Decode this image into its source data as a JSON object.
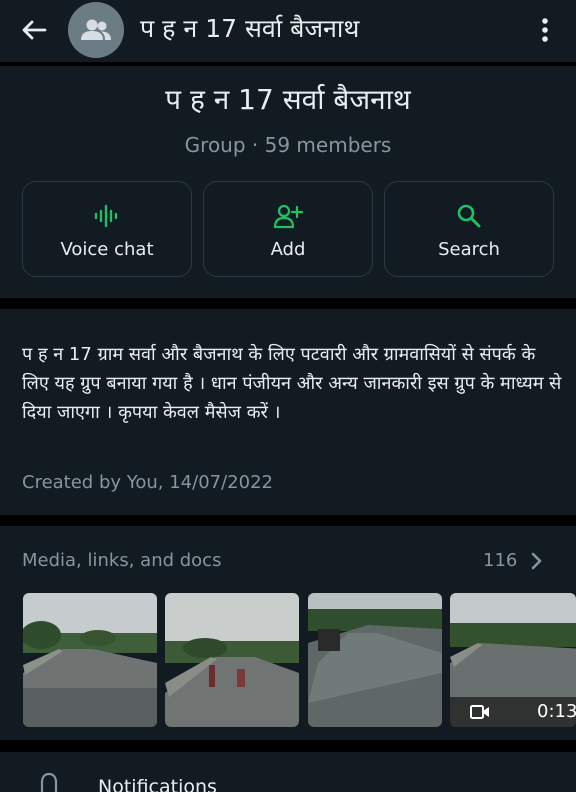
{
  "header": {
    "title": "प ह न 17 सर्वा बैजनाथ",
    "back_icon": "arrow-left-icon",
    "avatar_icon": "group-icon",
    "menu_icon": "more-vertical-icon"
  },
  "profile": {
    "name": "प ह न 17 सर्वा बैजनाथ",
    "subtitle": "Group · 59 members"
  },
  "actions": [
    {
      "label": "Voice chat",
      "icon": "voice-chat-icon"
    },
    {
      "label": "Add",
      "icon": "add-person-icon"
    },
    {
      "label": "Search",
      "icon": "search-icon"
    }
  ],
  "description": {
    "text": "प ह न 17 ग्राम सर्वा और बैजनाथ के लिए पटवारी और ग्रामवासियों से संपर्क के लिए यह ग्रुप बनाया गया है । धान पंजीयन और अन्य जानकारी इस ग्रुप के माध्यम से दिया जाएगा । कृपया केवल मैसेज करें ।",
    "created": "Created by You, 14/07/2022"
  },
  "media": {
    "title": "Media, links, and docs",
    "count": "116",
    "video_duration": "0:13"
  },
  "notifications": {
    "label": "Notifications",
    "icon": "bell-icon"
  },
  "colors": {
    "accent": "#21c063",
    "background": "#111b21",
    "separator": "#000000",
    "secondary_text": "#8696a0"
  }
}
